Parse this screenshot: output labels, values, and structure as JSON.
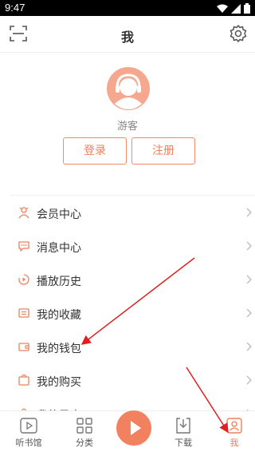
{
  "status": {
    "time": "9:47"
  },
  "header": {
    "title": "我",
    "scan_icon": "scan-icon",
    "settings_icon": "gear-icon"
  },
  "profile": {
    "username": "游客",
    "login_label": "登录",
    "register_label": "注册"
  },
  "menu": {
    "items": [
      {
        "label": "会员中心",
        "icon": "member-icon"
      },
      {
        "label": "消息中心",
        "icon": "message-icon"
      },
      {
        "label": "播放历史",
        "icon": "history-icon"
      },
      {
        "label": "我的收藏",
        "icon": "favorite-icon"
      },
      {
        "label": "我的钱包",
        "icon": "wallet-icon"
      },
      {
        "label": "我的购买",
        "icon": "purchase-icon"
      },
      {
        "label": "我的录音",
        "icon": "recording-icon"
      }
    ]
  },
  "tabbar": {
    "tabs": [
      {
        "label": "听书馆",
        "icon": "book-hall-icon"
      },
      {
        "label": "分类",
        "icon": "category-icon"
      },
      {
        "label": "下载",
        "icon": "download-icon"
      },
      {
        "label": "我",
        "icon": "profile-icon"
      }
    ],
    "active": "我"
  },
  "colors": {
    "accent": "#f07f5a",
    "annotation": "#e02020"
  }
}
